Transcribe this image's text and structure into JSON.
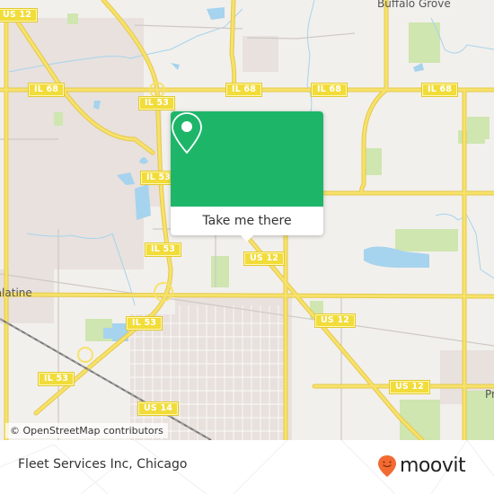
{
  "map": {
    "shields": [
      {
        "id": "us12-top-left",
        "label": "US 12"
      },
      {
        "id": "il68-west",
        "label": "IL 68"
      },
      {
        "id": "il68-center",
        "label": "IL 68"
      },
      {
        "id": "il68-mid",
        "label": "IL 68"
      },
      {
        "id": "il68-east",
        "label": "IL 68"
      },
      {
        "id": "il53-north",
        "label": "IL 53"
      },
      {
        "id": "il53-upper",
        "label": "IL 53"
      },
      {
        "id": "il53-middle",
        "label": "IL 53"
      },
      {
        "id": "il53-lower",
        "label": "IL 53"
      },
      {
        "id": "il53-southwest",
        "label": "IL 53"
      },
      {
        "id": "us12-center",
        "label": "US 12"
      },
      {
        "id": "us12-mid",
        "label": "US 12"
      },
      {
        "id": "us12-south",
        "label": "US 12"
      },
      {
        "id": "us14",
        "label": "US 14"
      }
    ],
    "places": [
      {
        "id": "buffalo-grove",
        "label": "Buffalo Grove"
      },
      {
        "id": "palatine",
        "label": "Palatine"
      },
      {
        "id": "prospect-heights",
        "label": "Prospect Heights"
      }
    ],
    "attribution": "© OpenStreetMap contributors",
    "colors": {
      "land": "#f2f0ec",
      "residential": "#e6dfdc",
      "park": "#cfe6b0",
      "water": "#a6d3ee",
      "road": "#f6e26b",
      "rail": "#777777"
    }
  },
  "popup": {
    "icon": "map-pin-icon",
    "button_label": "Take me there",
    "color": "#1db669"
  },
  "footer": {
    "title": "Fleet Services Inc, Chicago",
    "logo_text": "moovit",
    "logo_color": "#f26a31"
  }
}
